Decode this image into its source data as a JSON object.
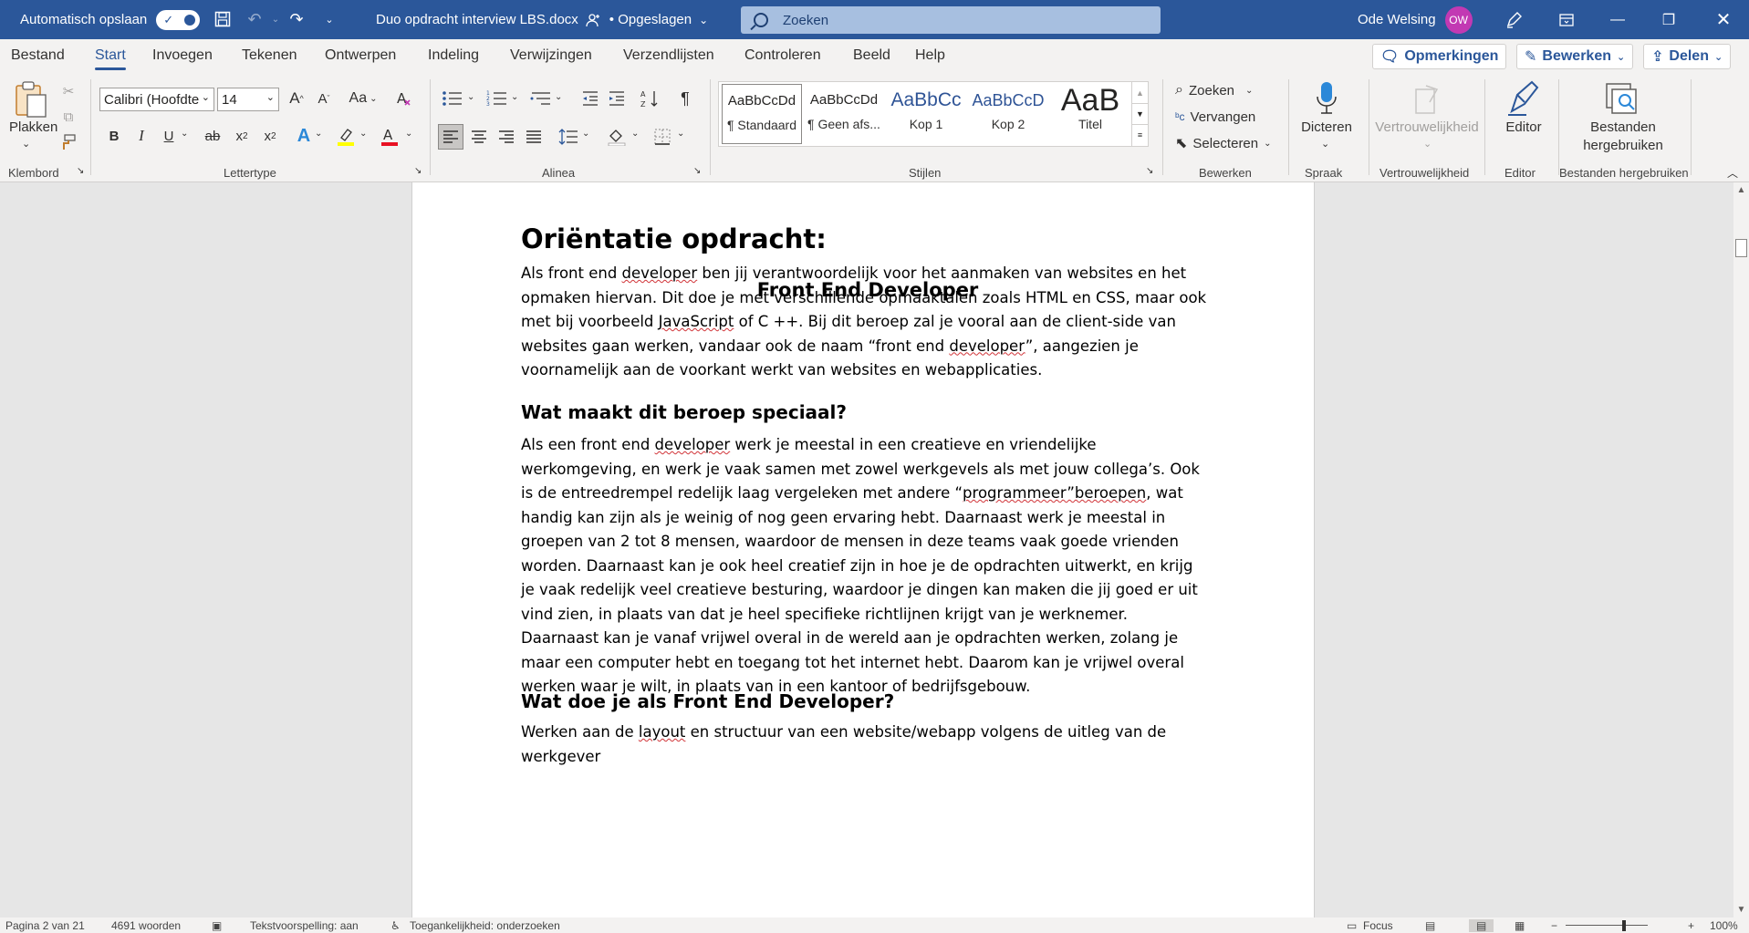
{
  "titlebar": {
    "autosave_label": "Automatisch opslaan",
    "doc_name": "Duo opdracht interview LBS.docx",
    "save_state": "• Opgeslagen",
    "search_placeholder": "Zoeken",
    "user_name": "Ode Welsing",
    "user_initials": "OW"
  },
  "menu": {
    "tabs": [
      "Bestand",
      "Start",
      "Invoegen",
      "Tekenen",
      "Ontwerpen",
      "Indeling",
      "Verwijzingen",
      "Verzendlijsten",
      "Controleren",
      "Beeld",
      "Help"
    ],
    "active_tab": "Start",
    "comments_label": "Opmerkingen",
    "edit_label": "Bewerken",
    "share_label": "Delen"
  },
  "ribbon": {
    "clipboard": {
      "paste_label": "Plakken",
      "group_label": "Klembord"
    },
    "font": {
      "font_name": "Calibri (Hoofdte",
      "font_size": "14",
      "group_label": "Lettertype"
    },
    "paragraph": {
      "group_label": "Alinea"
    },
    "styles": {
      "group_label": "Stijlen",
      "items": [
        {
          "preview": "AaBbCcDd",
          "name": "¶ Standaard"
        },
        {
          "preview": "AaBbCcDd",
          "name": "¶ Geen afs..."
        },
        {
          "preview": "AaBbCc",
          "name": "Kop 1"
        },
        {
          "preview": "AaBbCcD",
          "name": "Kop 2"
        },
        {
          "preview": "AaB",
          "name": "Titel"
        }
      ]
    },
    "editing": {
      "find_label": "Zoeken",
      "replace_label": "Vervangen",
      "select_label": "Selecteren",
      "group_label": "Bewerken"
    },
    "voice": {
      "dictate_label": "Dicteren",
      "group_label": "Spraak"
    },
    "sensitivity": {
      "label": "Vertrouwelijkheid",
      "group_label": "Vertrouwelijkheid"
    },
    "editor": {
      "label": "Editor",
      "group_label": "Editor"
    },
    "reuse": {
      "label_line1": "Bestanden",
      "label_line2": "hergebruiken",
      "group_label": "Bestanden hergebruiken"
    }
  },
  "document": {
    "title": "Oriëntatie opdracht:",
    "subtitle": "Front End Developer",
    "intro": {
      "before_1": "Als front end ",
      "sq_1": "developer",
      "mid_1": " ben jij verantwoordelijk voor het aanmaken van websites en het opmaken hiervan. Dit doe je met verschillende opmaaktalen zoals HTML en CSS, maar ook met bij voorbeeld ",
      "sq_2": "JavaScript",
      "mid_2": " of C ++. Bij dit beroep zal je vooral aan de client-side van websites gaan werken, vandaar ook de naam “front end ",
      "sq_3": "developer",
      "after": "”, aangezien je voornamelijk aan de voorkant werkt van websites en webapplicaties."
    },
    "h_special": "Wat maakt dit beroep speciaal?",
    "special": {
      "before_1": "Als een front end ",
      "sq_1": "developer",
      "mid_1": " werk je meestal in een creatieve en vriendelijke werkomgeving, en werk je vaak samen met zowel werkgevels als met jouw collega’s. Ook is de entreedrempel redelijk laag vergeleken met andere “",
      "sq_2": "programmeer”beroepen",
      "after": ", wat handig kan zijn als je weinig of nog geen ervaring hebt. Daarnaast werk je meestal in groepen van 2 tot 8 mensen, waardoor de mensen in deze teams vaak goede vrienden worden. Daarnaast kan je ook heel creatief zijn in hoe je de opdrachten uitwerkt, en krijg je vaak redelijk veel creatieve besturing, waardoor je dingen kan maken die jij goed er uit vind zien, in plaats van dat je heel specifieke richtlijnen krijgt van je werknemer. Daarnaast kan je vanaf vrijwel overal in de wereld aan je opdrachten werken, zolang je maar een computer hebt en toegang tot het internet hebt. Daarom kan je vrijwel overal werken waar je wilt, in plaats van in een kantoor of bedrijfsgebouw."
    },
    "h_what": "Wat doe je als Front End Developer?",
    "what": {
      "before": "Werken aan de ",
      "sq": "layout",
      "after": " en structuur van een website/webapp volgens de uitleg van de werkgever"
    }
  },
  "statusbar": {
    "page": "Pagina 2 van 21",
    "words": "4691 woorden",
    "spelling": "Tekstvoorspelling: aan",
    "accessibility": "Toegankelijkheid: onderzoeken",
    "focus": "Focus",
    "zoom": "100%"
  },
  "colors": {
    "brand": "#2b579a",
    "avatar": "#c239b3",
    "highlight": "#ffff00",
    "font_color": "#e81123"
  }
}
